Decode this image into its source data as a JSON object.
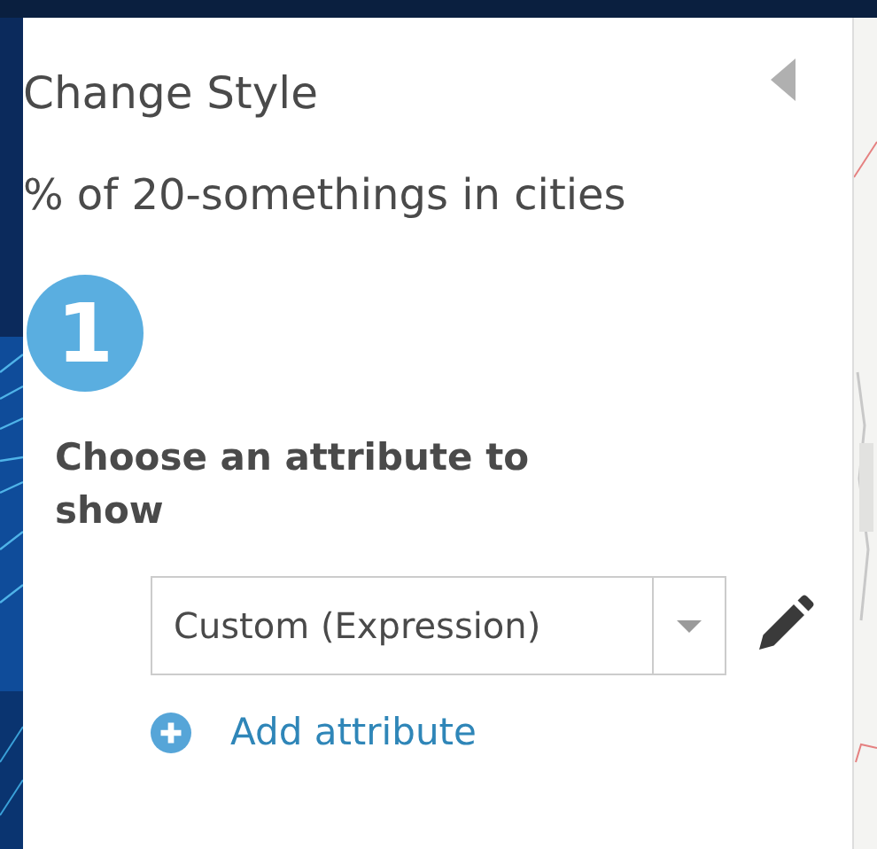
{
  "panel": {
    "title": "Change Style",
    "subtitle": "% of 20-somethings in cities",
    "collapsed": false
  },
  "step": {
    "number": "1",
    "heading": "Choose an attribute to show"
  },
  "attribute_select": {
    "value": "Custom (Expression)"
  },
  "add_link": {
    "label": "Add attribute"
  }
}
